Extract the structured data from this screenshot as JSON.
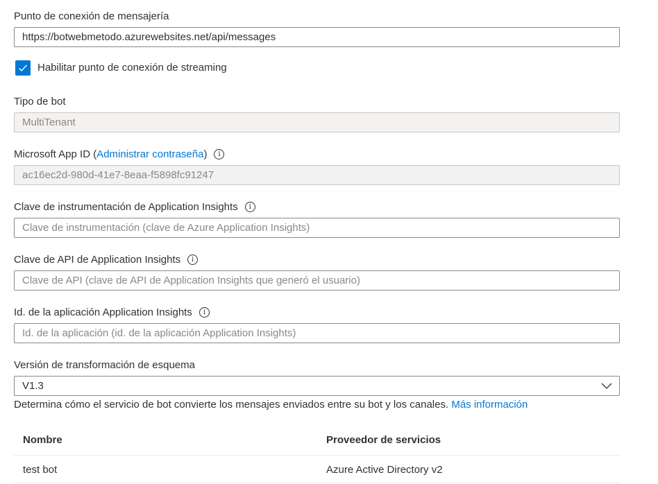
{
  "messaging_endpoint": {
    "label": "Punto de conexión de mensajería",
    "value": "https://botwebmetodo.azurewebsites.net/api/messages"
  },
  "streaming": {
    "label": "Habilitar punto de conexión de streaming",
    "checked": true
  },
  "bot_type": {
    "label": "Tipo de bot",
    "value": "MultiTenant"
  },
  "app_id": {
    "label": "Microsoft App ID (",
    "link": "Administrar contraseña",
    "label_end": ")",
    "value": "ac16ec2d-980d-41e7-8eaa-f5898fc91247"
  },
  "insights_key": {
    "label": "Clave de instrumentación de Application Insights",
    "placeholder": "Clave de instrumentación (clave de Azure Application Insights)"
  },
  "insights_api_key": {
    "label": "Clave de API de Application Insights",
    "placeholder": "Clave de API (clave de API de Application Insights que generó el usuario)"
  },
  "insights_app_id": {
    "label": "Id. de la aplicación Application Insights",
    "placeholder": "Id. de la aplicación (id. de la aplicación Application Insights)"
  },
  "schema_version": {
    "label": "Versión de transformación de esquema",
    "value": "V1.3",
    "description": "Determina cómo el servicio de bot convierte los mensajes enviados entre su bot y los canales.",
    "more_link": "Más información"
  },
  "table": {
    "headers": [
      "Nombre",
      "Proveedor de servicios"
    ],
    "rows": [
      [
        "test bot",
        "Azure Active Directory v2"
      ]
    ]
  },
  "colors": {
    "accent": "#0078d4",
    "readonly_bg": "#f3f2f1"
  }
}
